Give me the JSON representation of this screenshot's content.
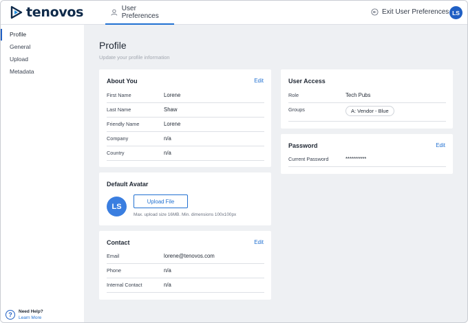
{
  "header": {
    "logo_text": "tenovos",
    "tab_label": "User Preferences",
    "exit_label": "Exit User Preferences",
    "user_initials": "LS"
  },
  "sidebar": {
    "items": [
      {
        "label": "Profile",
        "active": true
      },
      {
        "label": "General",
        "active": false
      },
      {
        "label": "Upload",
        "active": false
      },
      {
        "label": "Metadata",
        "active": false
      }
    ],
    "help_title": "Need Help?",
    "help_link": "Learn More"
  },
  "page": {
    "title": "Profile",
    "subtitle": "Update your profile information"
  },
  "about": {
    "title": "About You",
    "edit_label": "Edit",
    "fields": [
      {
        "label": "First Name",
        "value": "Lorene"
      },
      {
        "label": "Last Name",
        "value": "Shaw"
      },
      {
        "label": "Friendly Name",
        "value": "Lorene"
      },
      {
        "label": "Company",
        "value": "n/a"
      },
      {
        "label": "Country",
        "value": "n/a"
      }
    ]
  },
  "avatar": {
    "title": "Default Avatar",
    "initials": "LS",
    "upload_label": "Upload File",
    "note": "Max. upload size 16MB. Min. dimensions 100x100px"
  },
  "contact": {
    "title": "Contact",
    "edit_label": "Edit",
    "fields": [
      {
        "label": "Email",
        "value": "lorene@tenovos.com"
      },
      {
        "label": "Phone",
        "value": "n/a"
      },
      {
        "label": "Internal Contact",
        "value": "n/a"
      }
    ]
  },
  "access": {
    "title": "User Access",
    "role_label": "Role",
    "role_value": "Tech Pubs",
    "groups_label": "Groups",
    "groups": [
      "A: Vendor - Blue"
    ]
  },
  "password": {
    "title": "Password",
    "edit_label": "Edit",
    "label": "Current Password",
    "value": "**********"
  },
  "colors": {
    "accent": "#1f6fd1",
    "avatar": "#3a7ee0",
    "background": "#eef0f3"
  },
  "icons": [
    "tenovos-logo-icon",
    "user-icon",
    "exit-icon",
    "help-icon"
  ]
}
